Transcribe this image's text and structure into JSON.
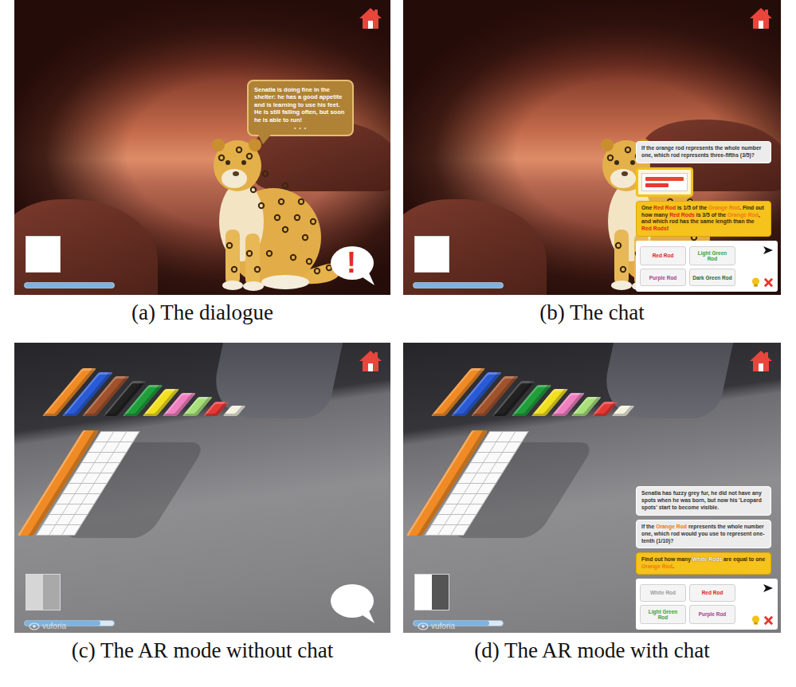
{
  "figure": {
    "panels": [
      {
        "kind": "cave",
        "caption": "(a) The dialogue",
        "slots": [
          {
            "color": "#ffffff"
          }
        ],
        "progress": {
          "level": 1
        },
        "dialogue": {
          "text": "Senatla is doing fine in the shelter: he has a good appetite and is learning to use his feet. He is still falling often, but soon he is able to run!",
          "pager": "• • •"
        },
        "bubble": {
          "text": "!"
        }
      },
      {
        "kind": "cave",
        "caption": "(b) The chat",
        "slots": [
          {
            "color": "#ffffff"
          }
        ],
        "progress": {
          "level": 1
        },
        "chat": {
          "messages": [
            {
              "kind": "question",
              "segments": [
                {
                  "text": "If the orange rod represents the whole number one, which rod represents three-fifths (3/5)?",
                  "color": "#333333"
                }
              ]
            },
            {
              "kind": "image",
              "rods": [
                {
                  "color": "#e8462e",
                  "units": 10
                },
                {
                  "color": "#e53935",
                  "units": 6
                }
              ]
            },
            {
              "kind": "task",
              "segments": [
                {
                  "text": "One ",
                  "color": "#3a2c00"
                },
                {
                  "text": "Red Rod",
                  "color": "#e0241c"
                },
                {
                  "text": " is 1/5 of the ",
                  "color": "#3a2c00"
                },
                {
                  "text": "Orange Rod",
                  "color": "#f07a10"
                },
                {
                  "text": ". Find out how many ",
                  "color": "#3a2c00"
                },
                {
                  "text": "Red Rods",
                  "color": "#e0241c"
                },
                {
                  "text": " is 3/5 of the ",
                  "color": "#3a2c00"
                },
                {
                  "text": "Orange Rod",
                  "color": "#f07a10"
                },
                {
                  "text": ", and which rod has the same length than the ",
                  "color": "#3a2c00"
                },
                {
                  "text": "Red Rods",
                  "color": "#e0241c"
                },
                {
                  "text": "!",
                  "color": "#3a2c00"
                }
              ]
            }
          ],
          "answers": [
            {
              "text": "Red Rod",
              "color": "#e0241c"
            },
            {
              "text": "Light Green Rod",
              "color": "#3aa23a"
            },
            {
              "text": "Purple Rod",
              "color": "#a8458c"
            },
            {
              "text": "Dark Green Rod",
              "color": "#1f6b2e"
            }
          ]
        }
      },
      {
        "kind": "ar",
        "caption": "(c) The AR mode without chat",
        "slots": [
          {
            "color": "#d6d6d6"
          },
          {
            "color": "#a9a9a9"
          }
        ],
        "progress": {
          "level": 0.85
        },
        "ar": {
          "rods": [
            {
              "color": "#f08a24",
              "units": 10
            },
            {
              "color": "#2a5bd7",
              "units": 9
            },
            {
              "color": "#a0522d",
              "units": 8
            },
            {
              "color": "#222222",
              "units": 7
            },
            {
              "color": "#1f9e3a",
              "units": 6
            },
            {
              "color": "#f2e01f",
              "units": 5
            },
            {
              "color": "#f080c0",
              "units": 4
            },
            {
              "color": "#a8e07a",
              "units": 3
            },
            {
              "color": "#e53935",
              "units": 2
            },
            {
              "color": "#f5f2e0",
              "units": 1
            }
          ],
          "grid": {
            "rows": 10,
            "cols": 3
          },
          "watermark": "vuforia"
        },
        "bubble": {
          "text": ""
        }
      },
      {
        "kind": "ar",
        "caption": "(d) The AR mode with chat",
        "slots": [
          {
            "color": "#ffffff"
          },
          {
            "color": "#555555"
          }
        ],
        "progress": {
          "level": 0.85
        },
        "ar": {
          "rods": [
            {
              "color": "#f08a24",
              "units": 10
            },
            {
              "color": "#2a5bd7",
              "units": 9
            },
            {
              "color": "#a0522d",
              "units": 8
            },
            {
              "color": "#222222",
              "units": 7
            },
            {
              "color": "#1f9e3a",
              "units": 6
            },
            {
              "color": "#f2e01f",
              "units": 5
            },
            {
              "color": "#f080c0",
              "units": 4
            },
            {
              "color": "#a8e07a",
              "units": 3
            },
            {
              "color": "#e53935",
              "units": 2
            },
            {
              "color": "#f5f2e0",
              "units": 1
            }
          ],
          "grid": {
            "rows": 10,
            "cols": 3
          },
          "watermark": "vuforia"
        },
        "chat": {
          "messages": [
            {
              "kind": "question",
              "segments": [
                {
                  "text": "Senatla has fuzzy grey fur, he did not have any spots when he was born, but now his 'Leopard spots' start to become visible.",
                  "color": "#333333"
                }
              ]
            },
            {
              "kind": "question",
              "segments": [
                {
                  "text": "If the ",
                  "color": "#333333"
                },
                {
                  "text": "Orange Rod",
                  "color": "#f07a10"
                },
                {
                  "text": " represents the whole number one, which rod would you use to represent one-tenth (1/10)?",
                  "color": "#333333"
                }
              ]
            },
            {
              "kind": "task",
              "segments": [
                {
                  "text": "Find out how many ",
                  "color": "#3a2c00"
                },
                {
                  "text": "White Rods",
                  "color": "#ffffff"
                },
                {
                  "text": " are equal to one ",
                  "color": "#3a2c00"
                },
                {
                  "text": "Orange Rod",
                  "color": "#f07a10"
                },
                {
                  "text": ".",
                  "color": "#3a2c00"
                }
              ]
            }
          ],
          "answers": [
            {
              "text": "White Rod",
              "color": "#9e9e9e"
            },
            {
              "text": "Red Rod",
              "color": "#e0241c"
            },
            {
              "text": "Light Green Rod",
              "color": "#3aa23a"
            },
            {
              "text": "Purple Rod",
              "color": "#a8458c"
            }
          ]
        }
      }
    ]
  }
}
